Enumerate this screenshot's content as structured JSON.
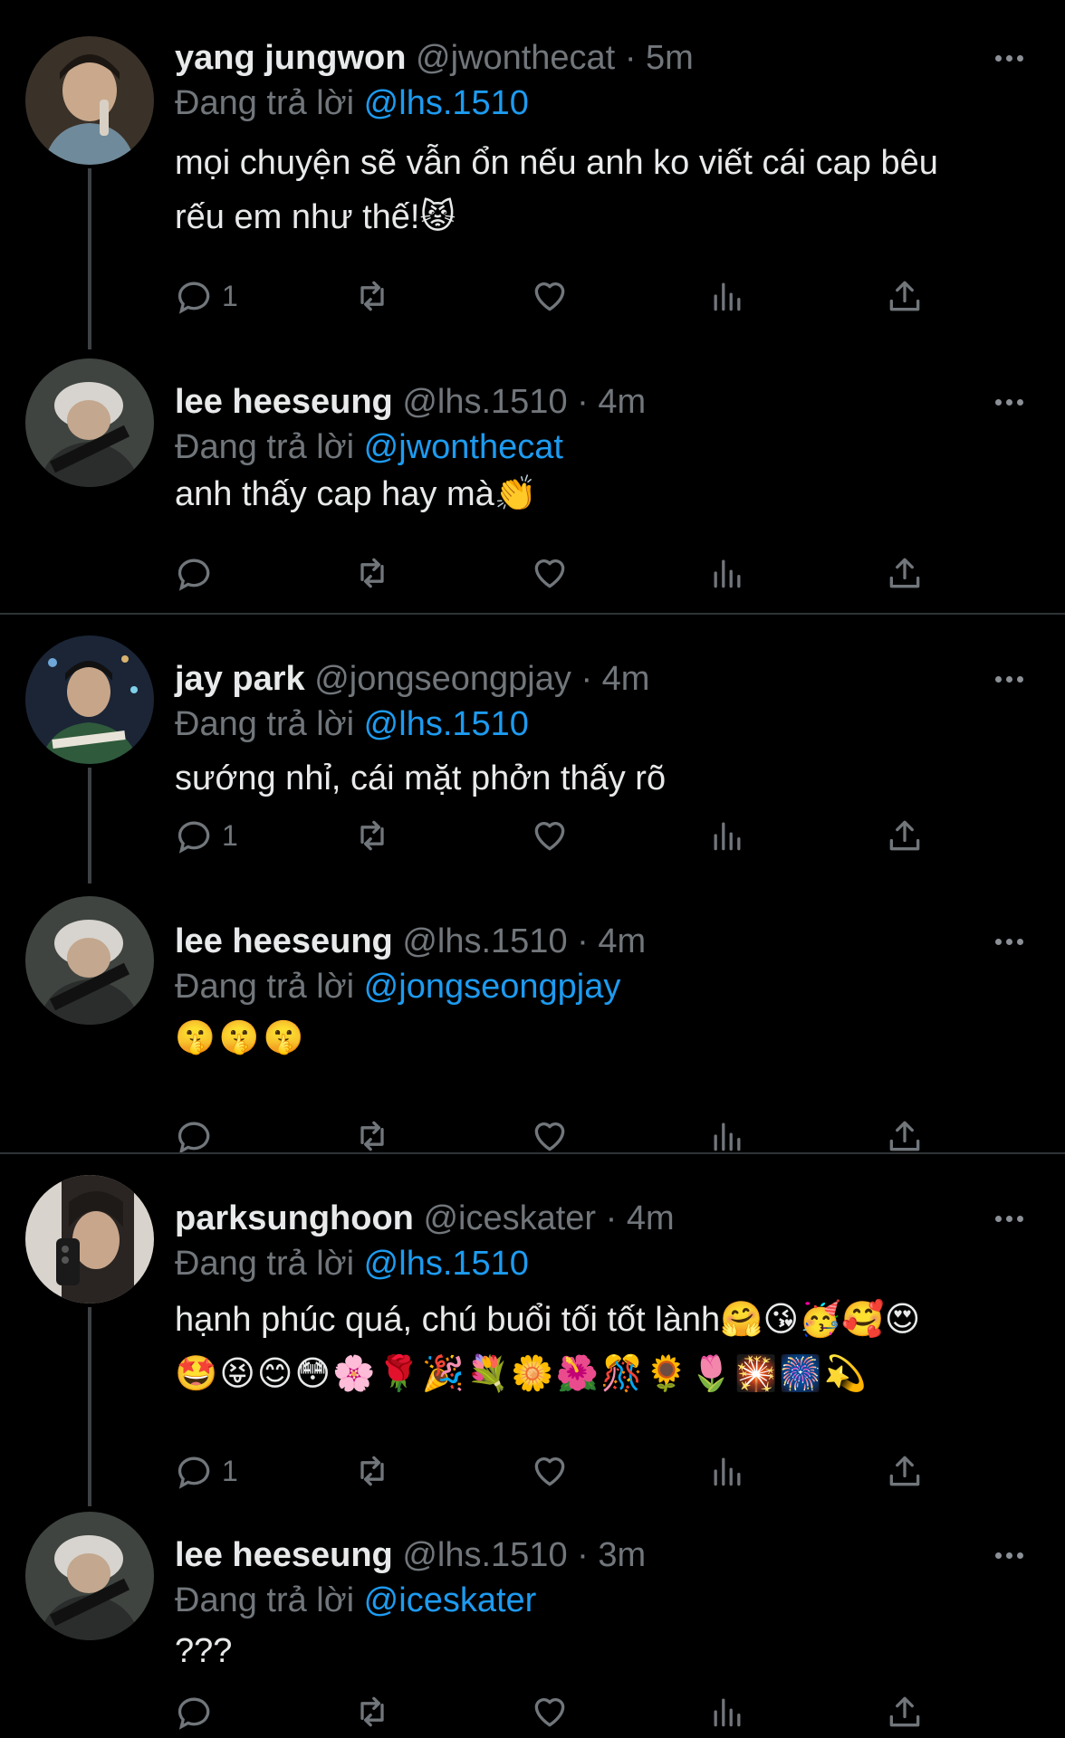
{
  "tweets": [
    {
      "name": "yang jungwon",
      "handle": "@jwonthecat",
      "time": "5m",
      "reply_prefix": "Đang trả lời",
      "reply_to": "@lhs.1510",
      "text_lines": [
        "mọi chuyện sẽ vẫn ổn nếu anh ko viết cái cap bêu",
        "rếu em như thế!😾"
      ],
      "reply_count": "1"
    },
    {
      "name": "lee heeseung",
      "handle": "@lhs.1510",
      "time": "4m",
      "reply_prefix": "Đang trả lời",
      "reply_to": "@jwonthecat",
      "text_lines": [
        "anh thấy cap hay mà👏"
      ],
      "reply_count": ""
    },
    {
      "name": "jay park",
      "handle": "@jongseongpjay",
      "time": "4m",
      "reply_prefix": "Đang trả lời",
      "reply_to": "@lhs.1510",
      "text_lines": [
        "sướng nhỉ, cái mặt phởn thấy rõ"
      ],
      "reply_count": "1"
    },
    {
      "name": "lee heeseung",
      "handle": "@lhs.1510",
      "time": "4m",
      "reply_prefix": "Đang trả lời",
      "reply_to": "@jongseongpjay",
      "text_lines": [
        "🤫🤫🤫"
      ],
      "reply_count": ""
    },
    {
      "name": "parksunghoon",
      "handle": "@iceskater",
      "time": "4m",
      "reply_prefix": "Đang trả lời",
      "reply_to": "@lhs.1510",
      "text_lines": [
        "hạnh phúc quá, chú buổi tối tốt lành🤗😘🥳🥰😍",
        "🤩😝😊😳🌸🌹🎉💐🌼🌺🎊🌻🌷🎇🎆💫"
      ],
      "reply_count": "1"
    },
    {
      "name": "lee heeseung",
      "handle": "@lhs.1510",
      "time": "3m",
      "reply_prefix": "Đang trả lời",
      "reply_to": "@iceskater",
      "text_lines": [
        "???"
      ],
      "reply_count": ""
    }
  ],
  "separator": "·",
  "icons": {
    "more": "more-dots-icon",
    "reply": "reply-bubble-icon",
    "retweet": "retweet-icon",
    "like": "heart-icon",
    "views": "analytics-bars-icon",
    "share": "share-upload-icon"
  },
  "colors": {
    "background": "#000000",
    "text": "#e7e9ea",
    "muted": "#71767b",
    "mention": "#1d9bf0",
    "divider": "#2f3336"
  }
}
